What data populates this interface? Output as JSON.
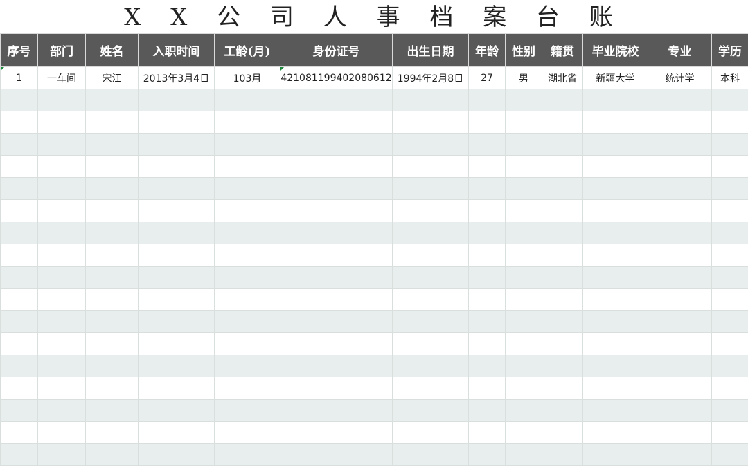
{
  "title": "X X 公 司 人 事 档 案 台 账",
  "columns": [
    "序号",
    "部门",
    "姓名",
    "入职时间",
    "工龄(月)",
    "身份证号",
    "出生日期",
    "年龄",
    "性别",
    "籍贯",
    "毕业院校",
    "专业",
    "学历"
  ],
  "rows": [
    [
      "1",
      "一车间",
      "宋江",
      "2013年3月4日",
      "103月",
      "421081199402080612",
      "1994年2月8日",
      "27",
      "男",
      "湖北省",
      "新疆大学",
      "统计学",
      "本科"
    ],
    [
      "",
      "",
      "",
      "",
      "",
      "",
      "",
      "",
      "",
      "",
      "",
      "",
      ""
    ],
    [
      "",
      "",
      "",
      "",
      "",
      "",
      "",
      "",
      "",
      "",
      "",
      "",
      ""
    ],
    [
      "",
      "",
      "",
      "",
      "",
      "",
      "",
      "",
      "",
      "",
      "",
      "",
      ""
    ],
    [
      "",
      "",
      "",
      "",
      "",
      "",
      "",
      "",
      "",
      "",
      "",
      "",
      ""
    ],
    [
      "",
      "",
      "",
      "",
      "",
      "",
      "",
      "",
      "",
      "",
      "",
      "",
      ""
    ],
    [
      "",
      "",
      "",
      "",
      "",
      "",
      "",
      "",
      "",
      "",
      "",
      "",
      ""
    ],
    [
      "",
      "",
      "",
      "",
      "",
      "",
      "",
      "",
      "",
      "",
      "",
      "",
      ""
    ],
    [
      "",
      "",
      "",
      "",
      "",
      "",
      "",
      "",
      "",
      "",
      "",
      "",
      ""
    ],
    [
      "",
      "",
      "",
      "",
      "",
      "",
      "",
      "",
      "",
      "",
      "",
      "",
      ""
    ],
    [
      "",
      "",
      "",
      "",
      "",
      "",
      "",
      "",
      "",
      "",
      "",
      "",
      ""
    ],
    [
      "",
      "",
      "",
      "",
      "",
      "",
      "",
      "",
      "",
      "",
      "",
      "",
      ""
    ],
    [
      "",
      "",
      "",
      "",
      "",
      "",
      "",
      "",
      "",
      "",
      "",
      "",
      ""
    ],
    [
      "",
      "",
      "",
      "",
      "",
      "",
      "",
      "",
      "",
      "",
      "",
      "",
      ""
    ],
    [
      "",
      "",
      "",
      "",
      "",
      "",
      "",
      "",
      "",
      "",
      "",
      "",
      ""
    ],
    [
      "",
      "",
      "",
      "",
      "",
      "",
      "",
      "",
      "",
      "",
      "",
      "",
      ""
    ],
    [
      "",
      "",
      "",
      "",
      "",
      "",
      "",
      "",
      "",
      "",
      "",
      "",
      ""
    ],
    [
      "",
      "",
      "",
      "",
      "",
      "",
      "",
      "",
      "",
      "",
      "",
      "",
      ""
    ]
  ],
  "colors": {
    "header_bg": "#595959",
    "header_text": "#ffffff",
    "row_alt_bg": "#e8eeed",
    "error_marker": "#1e8a3e"
  }
}
